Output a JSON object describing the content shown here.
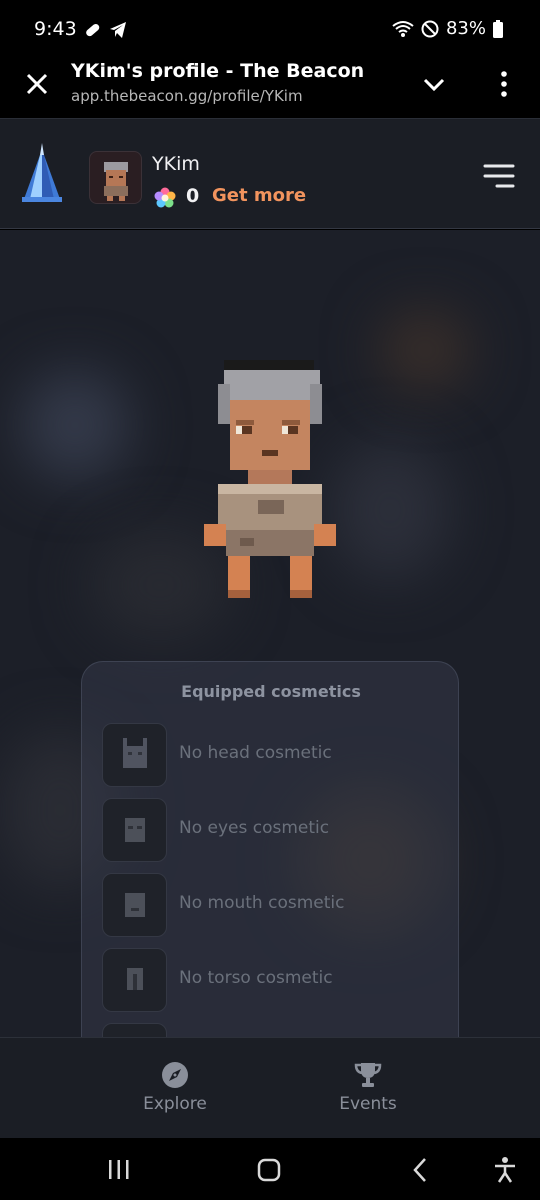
{
  "status_bar": {
    "time": "9:43",
    "battery": "83%"
  },
  "browser": {
    "title": "YKim's profile - The Beacon",
    "url": "app.thebeacon.gg/profile/YKim"
  },
  "header": {
    "username": "YKim",
    "gem_count": "0",
    "get_more_label": "Get more"
  },
  "cosmetics": {
    "title": "Equipped cosmetics",
    "items": [
      {
        "label": "No head cosmetic",
        "icon": "head-silhouette-icon"
      },
      {
        "label": "No eyes cosmetic",
        "icon": "eyes-silhouette-icon"
      },
      {
        "label": "No mouth cosmetic",
        "icon": "mouth-silhouette-icon"
      },
      {
        "label": "No torso cosmetic",
        "icon": "torso-silhouette-icon"
      }
    ]
  },
  "bottom_nav": {
    "items": [
      {
        "label": "Explore",
        "icon": "compass-icon"
      },
      {
        "label": "Events",
        "icon": "trophy-icon"
      }
    ]
  },
  "colors": {
    "accent": "#f2945e",
    "header_bg": "#1b1e25",
    "scene_bg": "#1c1f28"
  }
}
